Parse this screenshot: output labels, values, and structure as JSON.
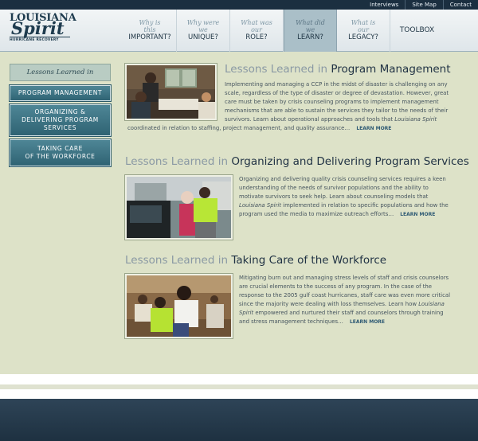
{
  "top_links": [
    "Interviews",
    "Site Map",
    "Contact"
  ],
  "logo": {
    "line1": "LOUISIANA",
    "line2": "Spirit",
    "line3": "HURRICANE RECOVERY"
  },
  "nav": [
    {
      "q": [
        "Why is",
        "this"
      ],
      "w": "IMPORTANT?"
    },
    {
      "q": [
        "Why were",
        "we"
      ],
      "w": "UNIQUE?"
    },
    {
      "q": [
        "What was",
        "our"
      ],
      "w": "ROLE?"
    },
    {
      "q": [
        "What did",
        "we"
      ],
      "w": "LEARN?"
    },
    {
      "q": [
        "What is",
        "our"
      ],
      "w": "LEGACY?"
    },
    {
      "w": "TOOLBOX"
    }
  ],
  "sidebar": {
    "heading": "Lessons Learned in",
    "items": [
      {
        "lines": [
          "PROGRAM MANAGEMENT"
        ]
      },
      {
        "lines": [
          "ORGANIZING &",
          "DELIVERING PROGRAM",
          "SERVICES"
        ]
      },
      {
        "lines": [
          "TAKING CARE",
          "OF THE WORKFORCE"
        ]
      }
    ]
  },
  "sections": {
    "pm": {
      "pre": "Lessons Learned in",
      "title": "Program Management",
      "text_a": "Implementing and managing a CCP in the midst of disaster is challenging on any scale, regardless of the type of disaster or degree of devastation. However, great care must be taken by crisis counseling programs to implement management mechanisms that are able to sustain the services they tailor to the needs of their survivors. Learn about operational approaches and tools that ",
      "text_em": "Louisiana Spirit",
      "text_b": " coordinated in relation to staffing, project management, and quality assurance…",
      "learn": "LEARN MORE"
    },
    "org": {
      "pre": "Lessons Learned in",
      "title": "Organizing and Delivering Program Services",
      "text_a": "Organizing and delivering quality crisis counseling services requires a keen understanding of the needs of survivor populations and the ability to motivate survivors to seek help. Learn about counseling models that ",
      "text_em": "Louisiana Spirit",
      "text_b": " implemented in relation to specific populations and how the program used the media to maximize outreach efforts…",
      "learn": "LEARN MORE"
    },
    "care": {
      "pre": "Lessons Learned in",
      "title": "Taking Care of the Workforce",
      "text_a": "Mitigating burn out and managing stress levels of staff and crisis counselors are crucial elements to the success of any program. In the case of the response to the 2005 gulf coast hurricanes, staff care was even more critical since the majority were dealing with loss themselves. Learn how ",
      "text_em": "Louisiana Spirit",
      "text_b": " empowered and nurtured their staff and counselors through training and stress management techniques…",
      "learn": "LEARN MORE"
    }
  }
}
